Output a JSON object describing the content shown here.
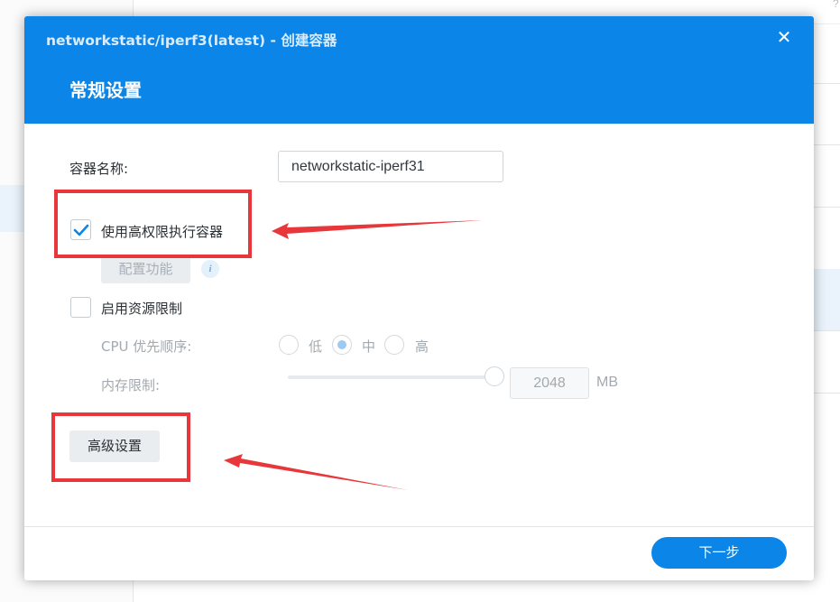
{
  "background": {
    "help_glyph": "?"
  },
  "dialog": {
    "title": "networkstatic/iperf3(latest) - 创建容器",
    "close_glyph": "✕",
    "section_title": "常规设置"
  },
  "form": {
    "container_name_label": "容器名称:",
    "container_name_value": "networkstatic-iperf31",
    "privileged_label": "使用高权限执行容器",
    "privileged_checked": true,
    "config_button": "配置功能",
    "info_glyph": "i",
    "resource_limit_label": "启用资源限制",
    "resource_limit_checked": false,
    "cpu_priority_label": "CPU 优先顺序:",
    "cpu_options": [
      "低",
      "中",
      "高"
    ],
    "cpu_selected": "中",
    "memory_label": "内存限制:",
    "memory_value": "2048",
    "memory_unit": "MB",
    "advanced_button": "高级设置"
  },
  "footer": {
    "next_button": "下一步"
  },
  "colors": {
    "primary": "#0b86e8",
    "annotation": "#e8373a"
  }
}
